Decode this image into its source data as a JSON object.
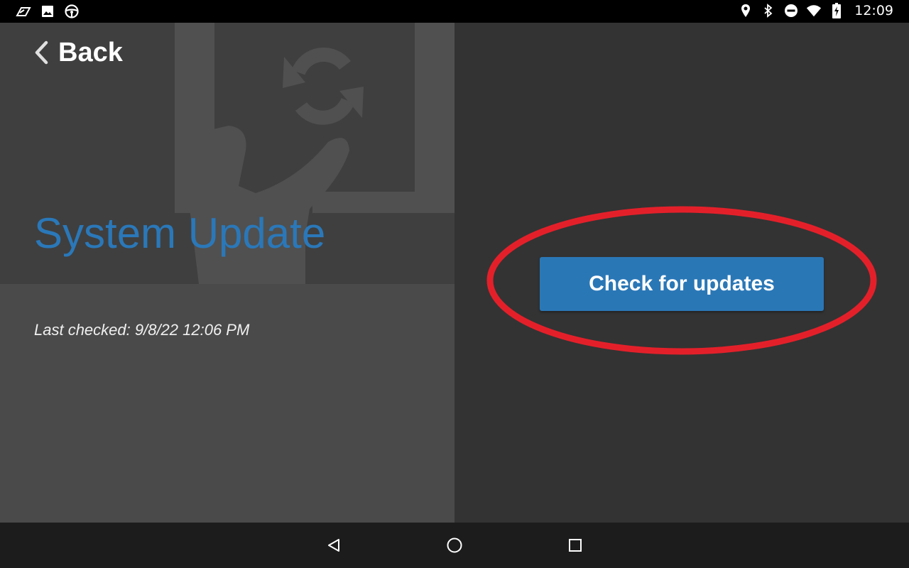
{
  "status_bar": {
    "time": "12:09",
    "left_icons": [
      "delivery-app-icon",
      "image-icon",
      "steering-wheel-icon"
    ],
    "right_icons": [
      "location-icon",
      "bluetooth-icon",
      "do-not-disturb-icon",
      "wifi-icon",
      "battery-charging-icon"
    ]
  },
  "header": {
    "back_label": "Back",
    "back_icon": "chevron-left-icon"
  },
  "main": {
    "title": "System Update",
    "last_checked": "Last checked: 9/8/22 12:06 PM",
    "check_button_label": "Check for updates"
  },
  "nav_bar": {
    "buttons": [
      "back-triangle-icon",
      "home-circle-icon",
      "recents-square-icon"
    ]
  },
  "colors": {
    "accent": "#2a78b9",
    "button": "#2a77b6",
    "highlight_ring": "#e3202a",
    "left_panel": "#4a4a4a",
    "right_panel": "#333333"
  }
}
